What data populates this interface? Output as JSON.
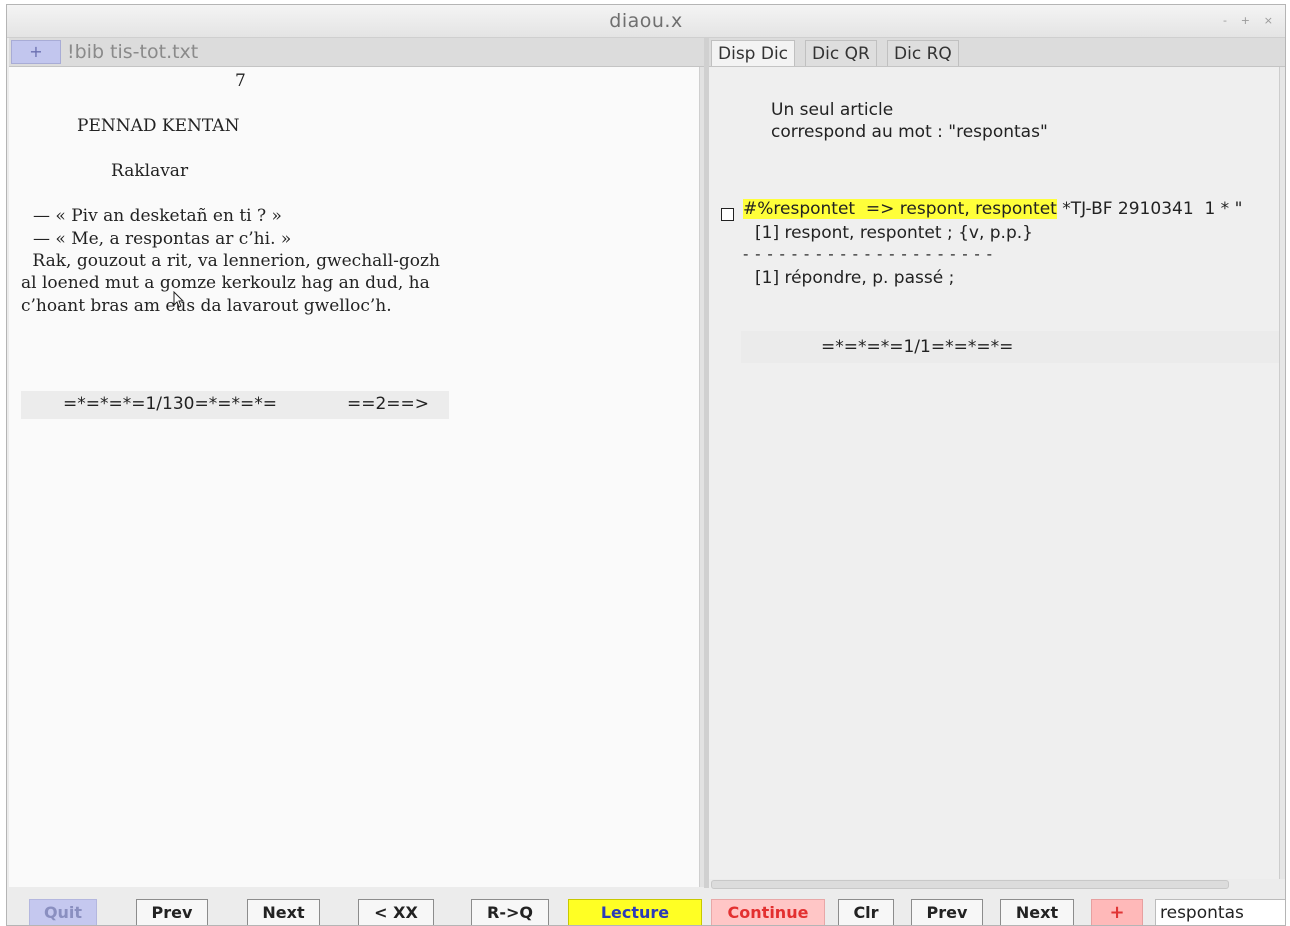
{
  "window": {
    "title": "diaou.x",
    "controls": {
      "minimize": "-",
      "maximize": "+",
      "close": "×"
    }
  },
  "left_panel": {
    "plus_tab": "+",
    "file_tab": "!bib tis-tot.txt",
    "text": {
      "page_number": "7",
      "heading": "PENNAD KENTAN",
      "subheading": "Raklavar",
      "line1": "— « Piv an desketañ en ti ? »",
      "line2": "— « Me, a respontas ar c’hi. »",
      "line3": " Rak, gouzout a rit, va lennerion, gwechall-gozh",
      "line4": "al loened mut a gomze kerkoulz hag an dud, ha",
      "line5": "c’hoant bras am eus da lavarout gwelloc’h."
    },
    "page_footer": {
      "counter": "=*=*=*=1/130=*=*=*=",
      "next": "==2==>"
    }
  },
  "right_panel": {
    "tabs": [
      {
        "label": "Disp Dic",
        "active": true
      },
      {
        "label": "Dic QR",
        "active": false
      },
      {
        "label": "Dic RQ",
        "active": false
      }
    ],
    "result": {
      "line1": "Un seul article",
      "line2": "correspond au mot : \"respontas\"",
      "entry_highlight": "#%respontet  => respont, respontet",
      "entry_rest": " *TJ-BF 2910341  1 * \"",
      "def1": "[1] respont, respontet ; {v, p.p.}",
      "separator": "- - - - - - - - - - - - - - - - - - - - -",
      "def2": "[1] répondre, p. passé ;",
      "footer": "=*=*=*=1/1=*=*=*="
    }
  },
  "bottom_left": {
    "quit": "Quit",
    "prev": "Prev",
    "next": "Next",
    "xx": "< XX",
    "rq": "R->Q",
    "lecture": "Lecture"
  },
  "bottom_right": {
    "continue": "Continue",
    "clr": "Clr",
    "prev": "Prev",
    "next": "Next",
    "plus": "+",
    "search_value": "respontas"
  },
  "colors": {
    "highlight": "#ffff3a",
    "lecture_bg": "#ffff24",
    "continue_bg": "#ffc6c6",
    "quit_bg": "#c5c8ef"
  }
}
